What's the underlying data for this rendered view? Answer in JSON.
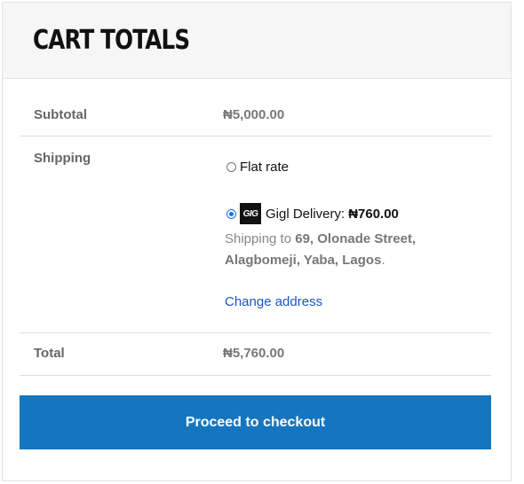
{
  "header": {
    "title": "CART TOTALS"
  },
  "subtotal": {
    "label": "Subtotal",
    "value": "₦5,000.00"
  },
  "shipping": {
    "label": "Shipping",
    "options": [
      {
        "label": "Flat rate",
        "selected": false
      },
      {
        "label": "Gigl Delivery:",
        "price": "₦760.00",
        "logo_text": "GIG",
        "selected": true
      }
    ],
    "ship_to_prefix": "Shipping to",
    "address": "69, Olonade Street, Alagbomeji, Yaba, Lagos",
    "ship_to_suffix": ".",
    "change_address": "Change address"
  },
  "total": {
    "label": "Total",
    "value": "₦5,760.00"
  },
  "checkout": {
    "label": "Proceed to checkout"
  },
  "colors": {
    "accent": "#1576bf",
    "link": "#1a56c5",
    "header_bg": "#f6f6f6"
  }
}
